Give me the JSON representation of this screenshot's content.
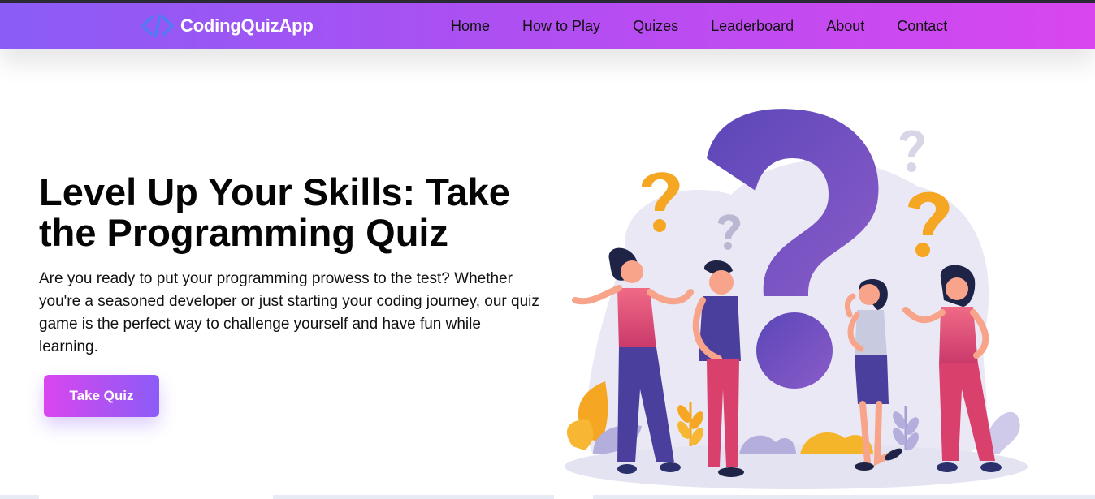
{
  "brand": {
    "name": "CodingQuizApp",
    "icon": "code-brackets-icon"
  },
  "nav": {
    "items": [
      {
        "label": "Home"
      },
      {
        "label": "How to Play"
      },
      {
        "label": "Quizes"
      },
      {
        "label": "Leaderboard"
      },
      {
        "label": "About"
      },
      {
        "label": "Contact"
      }
    ]
  },
  "hero": {
    "title": "Level Up Your Skills: Take the Programming Quiz",
    "description": "Are you ready to put your programming prowess to the test? Whether you're a seasoned developer or just starting your coding journey, our quiz game is the perfect way to challenge yourself and have fun while learning.",
    "cta_label": "Take Quiz"
  },
  "colors": {
    "nav_gradient_start": "#8b5cf6",
    "nav_gradient_end": "#d946ef",
    "question_mark": "#6d4fc0",
    "accent_orange": "#f5a623"
  }
}
